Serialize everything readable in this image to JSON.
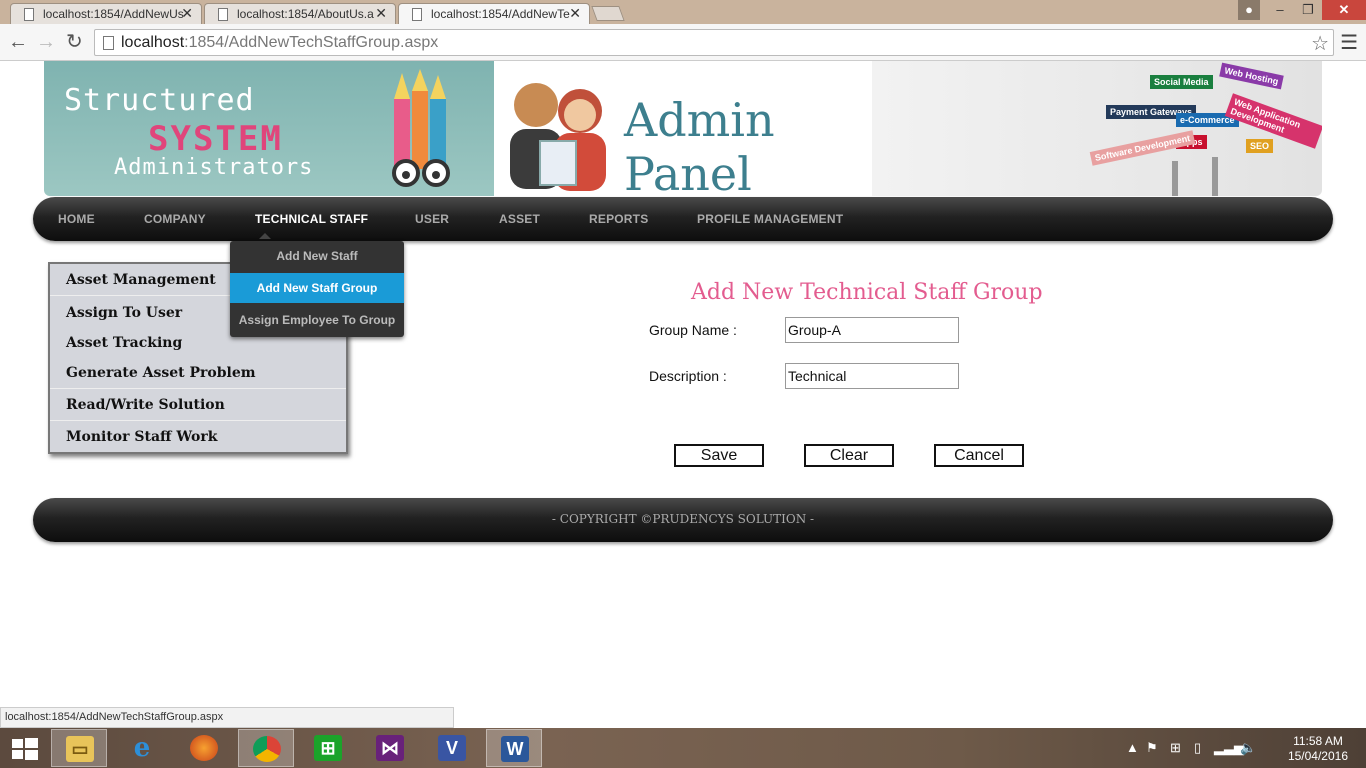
{
  "browser": {
    "tabs": [
      {
        "title": "localhost:1854/AddNewUs"
      },
      {
        "title": "localhost:1854/AboutUs.a"
      },
      {
        "title": "localhost:1854/AddNewTe"
      }
    ],
    "url_host": "localhost",
    "url_rest": ":1854/AddNewTechStaffGroup.aspx",
    "status_url": "localhost:1854/AddNewTechStaffGroup.aspx"
  },
  "banner": {
    "logo_line1": "Structured",
    "logo_line2": "SYSTEM",
    "logo_line3": "Administrators",
    "panel_title": "Admin Panel",
    "signs": [
      "Social Media",
      "Web Hosting",
      "Payment Gateways",
      "e-Commerce",
      "Web Application Development",
      "Apps",
      "SEO",
      "Software Development"
    ]
  },
  "nav": {
    "items": [
      "HOME",
      "COMPANY",
      "TECHNICAL STAFF",
      "USER",
      "ASSET",
      "REPORTS",
      "PROFILE MANAGEMENT"
    ],
    "active": "TECHNICAL STAFF",
    "dropdown": [
      "Add New Staff",
      "Add New Staff Group",
      "Assign Employee To Group"
    ],
    "dropdown_selected": "Add New Staff Group"
  },
  "sidemenu": {
    "items": [
      "Asset Management",
      "Assign To User",
      "Asset Tracking",
      "Generate Asset Problem",
      "Read/Write Solution",
      "Monitor Staff Work"
    ]
  },
  "form": {
    "title": "Add New Technical Staff Group",
    "group_name_label": "Group Name :",
    "group_name_value": "Group-A",
    "description_label": "Description :",
    "description_value": "Technical",
    "buttons": {
      "save": "Save",
      "clear": "Clear",
      "cancel": "Cancel"
    }
  },
  "footer": {
    "text": "- COPYRIGHT ©PRUDENCYS SOLUTION -"
  },
  "taskbar": {
    "apps": [
      "start-icon",
      "file-explorer-icon",
      "internet-explorer-icon",
      "firefox-icon",
      "chrome-icon",
      "store-icon",
      "visual-studio-icon",
      "visio-icon",
      "word-icon"
    ],
    "time": "11:58 AM",
    "date": "15/04/2016"
  },
  "colors": {
    "accent_pink": "#e35c8f",
    "dropdown_selected": "#1a9bd7",
    "panel_teal": "#3d7f8e"
  }
}
